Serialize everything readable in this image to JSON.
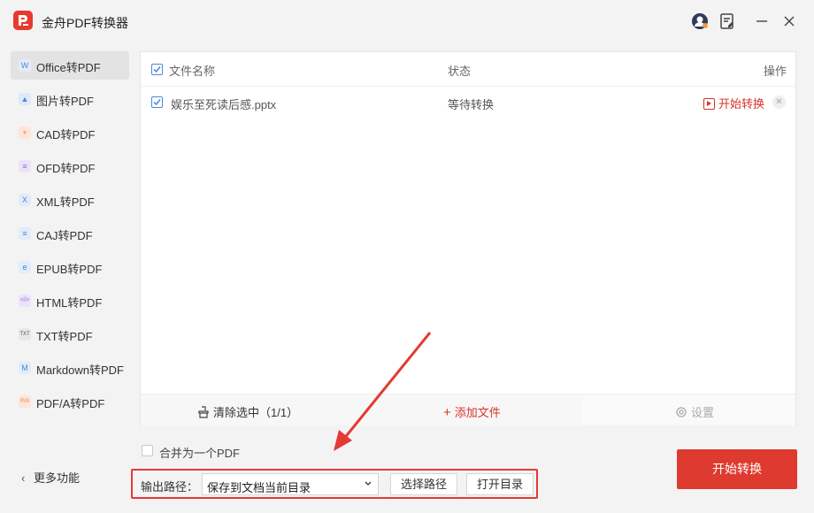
{
  "app": {
    "title": "金舟PDF转换器"
  },
  "titlebar": {
    "icons": [
      "avatar-icon",
      "feedback-icon",
      "minimize-icon",
      "close-icon"
    ],
    "min_glyph": "—",
    "close_glyph": "✕"
  },
  "sidebar": {
    "items": [
      {
        "label": "Office转PDF",
        "icon": "office-icon",
        "glyph": "W",
        "color": "#4a88d9"
      },
      {
        "label": "图片转PDF",
        "icon": "image-icon",
        "glyph": "▲",
        "color": "#4a88d9"
      },
      {
        "label": "CAD转PDF",
        "icon": "cad-icon",
        "glyph": "+",
        "color": "#f07c3a"
      },
      {
        "label": "OFD转PDF",
        "icon": "ofd-icon",
        "glyph": "≡",
        "color": "#8a6ad8"
      },
      {
        "label": "XML转PDF",
        "icon": "xml-icon",
        "glyph": "X",
        "color": "#4a88d9"
      },
      {
        "label": "CAJ转PDF",
        "icon": "caj-icon",
        "glyph": "≡",
        "color": "#4a88d9"
      },
      {
        "label": "EPUB转PDF",
        "icon": "epub-icon",
        "glyph": "e",
        "color": "#4a88d9"
      },
      {
        "label": "HTML转PDF",
        "icon": "html-icon",
        "glyph": "</>",
        "color": "#8a6ad8"
      },
      {
        "label": "TXT转PDF",
        "icon": "txt-icon",
        "glyph": "TXT",
        "color": "#555555"
      },
      {
        "label": "Markdown转PDF",
        "icon": "markdown-icon",
        "glyph": "M",
        "color": "#4a88d9"
      },
      {
        "label": "PDF/A转PDF",
        "icon": "pdfa-icon",
        "glyph": "P/A",
        "color": "#f07c3a"
      }
    ],
    "active_index": 0,
    "more_label": "更多功能"
  },
  "file_table": {
    "columns": {
      "name": "文件名称",
      "status": "状态",
      "action": "操作"
    },
    "rows": [
      {
        "name": "娱乐至死读后感.pptx",
        "status": "等待转换",
        "action": "开始转换",
        "checked": true
      }
    ],
    "header_checked": true
  },
  "bottom_bar": {
    "clear": "清除选中（1/1）",
    "add": "添加文件",
    "settings": "设置"
  },
  "merge": {
    "label": "合并为一个PDF",
    "checked": false
  },
  "output": {
    "label": "输出路径：",
    "selected": "保存到文档当前目录",
    "choose_button": "选择路径",
    "open_button": "打开目录"
  },
  "convert_button": "开始转换",
  "colors": {
    "accent": "#df3a30",
    "check": "#4a88d9",
    "highlight_box": "#e53935"
  }
}
